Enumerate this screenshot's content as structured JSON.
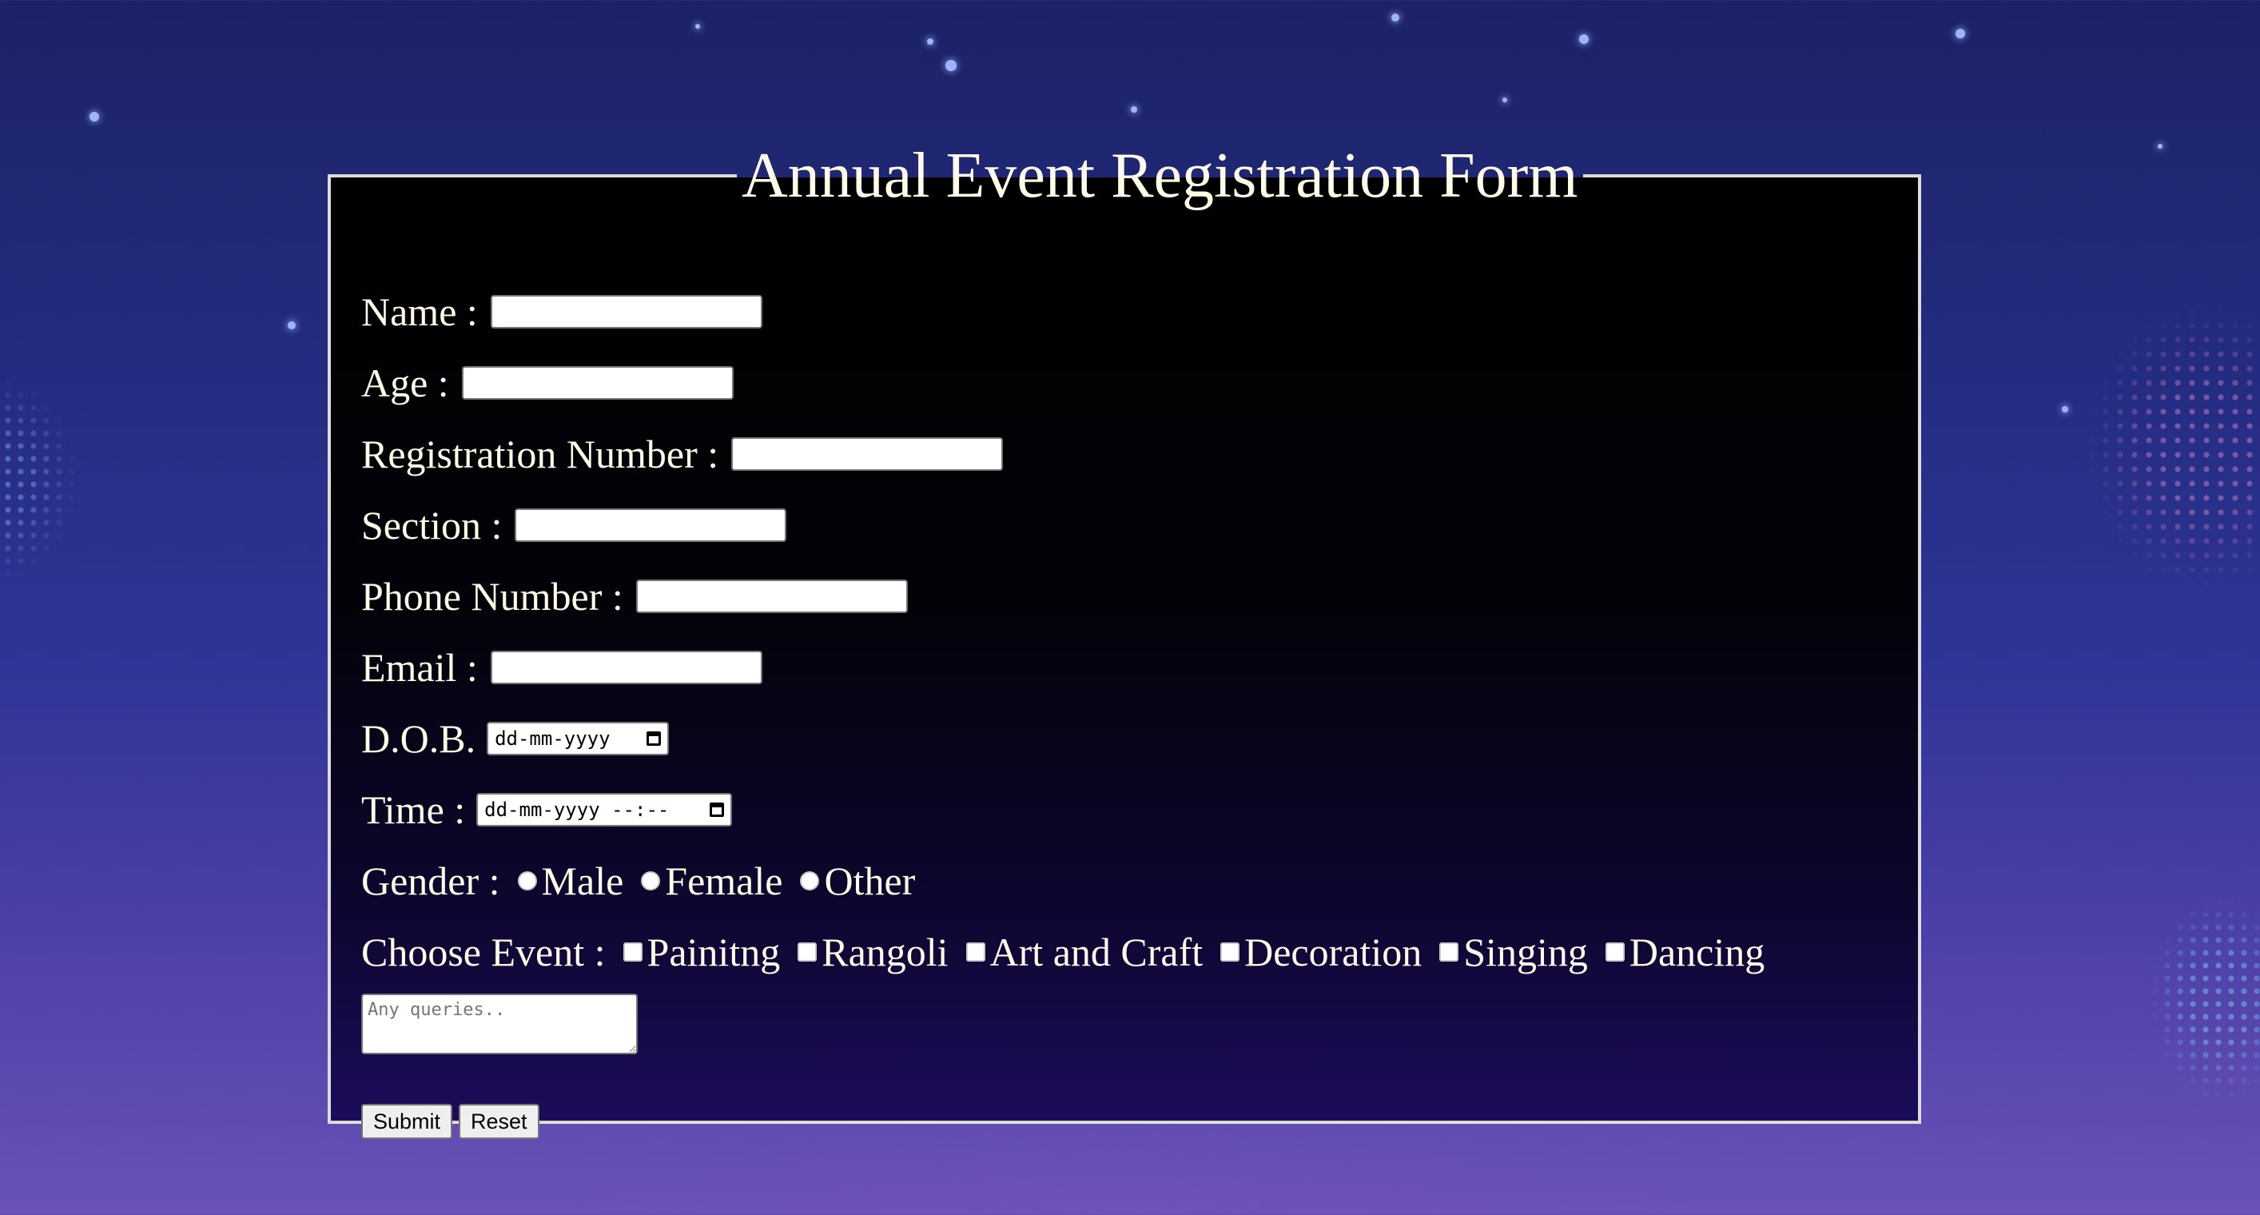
{
  "form": {
    "title": "Annual Event Registration Form",
    "fields": {
      "name": {
        "label": "Name :",
        "value": ""
      },
      "age": {
        "label": "Age :",
        "value": ""
      },
      "registration_number": {
        "label": "Registration Number :",
        "value": ""
      },
      "section": {
        "label": "Section :",
        "value": ""
      },
      "phone_number": {
        "label": "Phone Number :",
        "value": ""
      },
      "email": {
        "label": "Email :",
        "value": ""
      },
      "dob": {
        "label": "D.O.B.",
        "placeholder": "dd-mm-yyyy"
      },
      "time": {
        "label": "Time :",
        "placeholder": "dd-mm-yyyy --:--"
      }
    },
    "gender": {
      "label": "Gender :",
      "options": [
        "Male",
        "Female",
        "Other"
      ]
    },
    "events": {
      "label": "Choose Event :",
      "options": [
        "Painitng",
        "Rangoli",
        "Art and Craft",
        "Decoration",
        "Singing",
        "Dancing"
      ]
    },
    "queries": {
      "placeholder": "Any queries.."
    },
    "buttons": {
      "submit": "Submit",
      "reset": "Reset"
    }
  },
  "colors": {
    "text": "#fffbe6",
    "panel": "#000000",
    "border": "#dcdcdc",
    "background_top": "#1c2266",
    "background_bottom": "#6a52b6"
  }
}
